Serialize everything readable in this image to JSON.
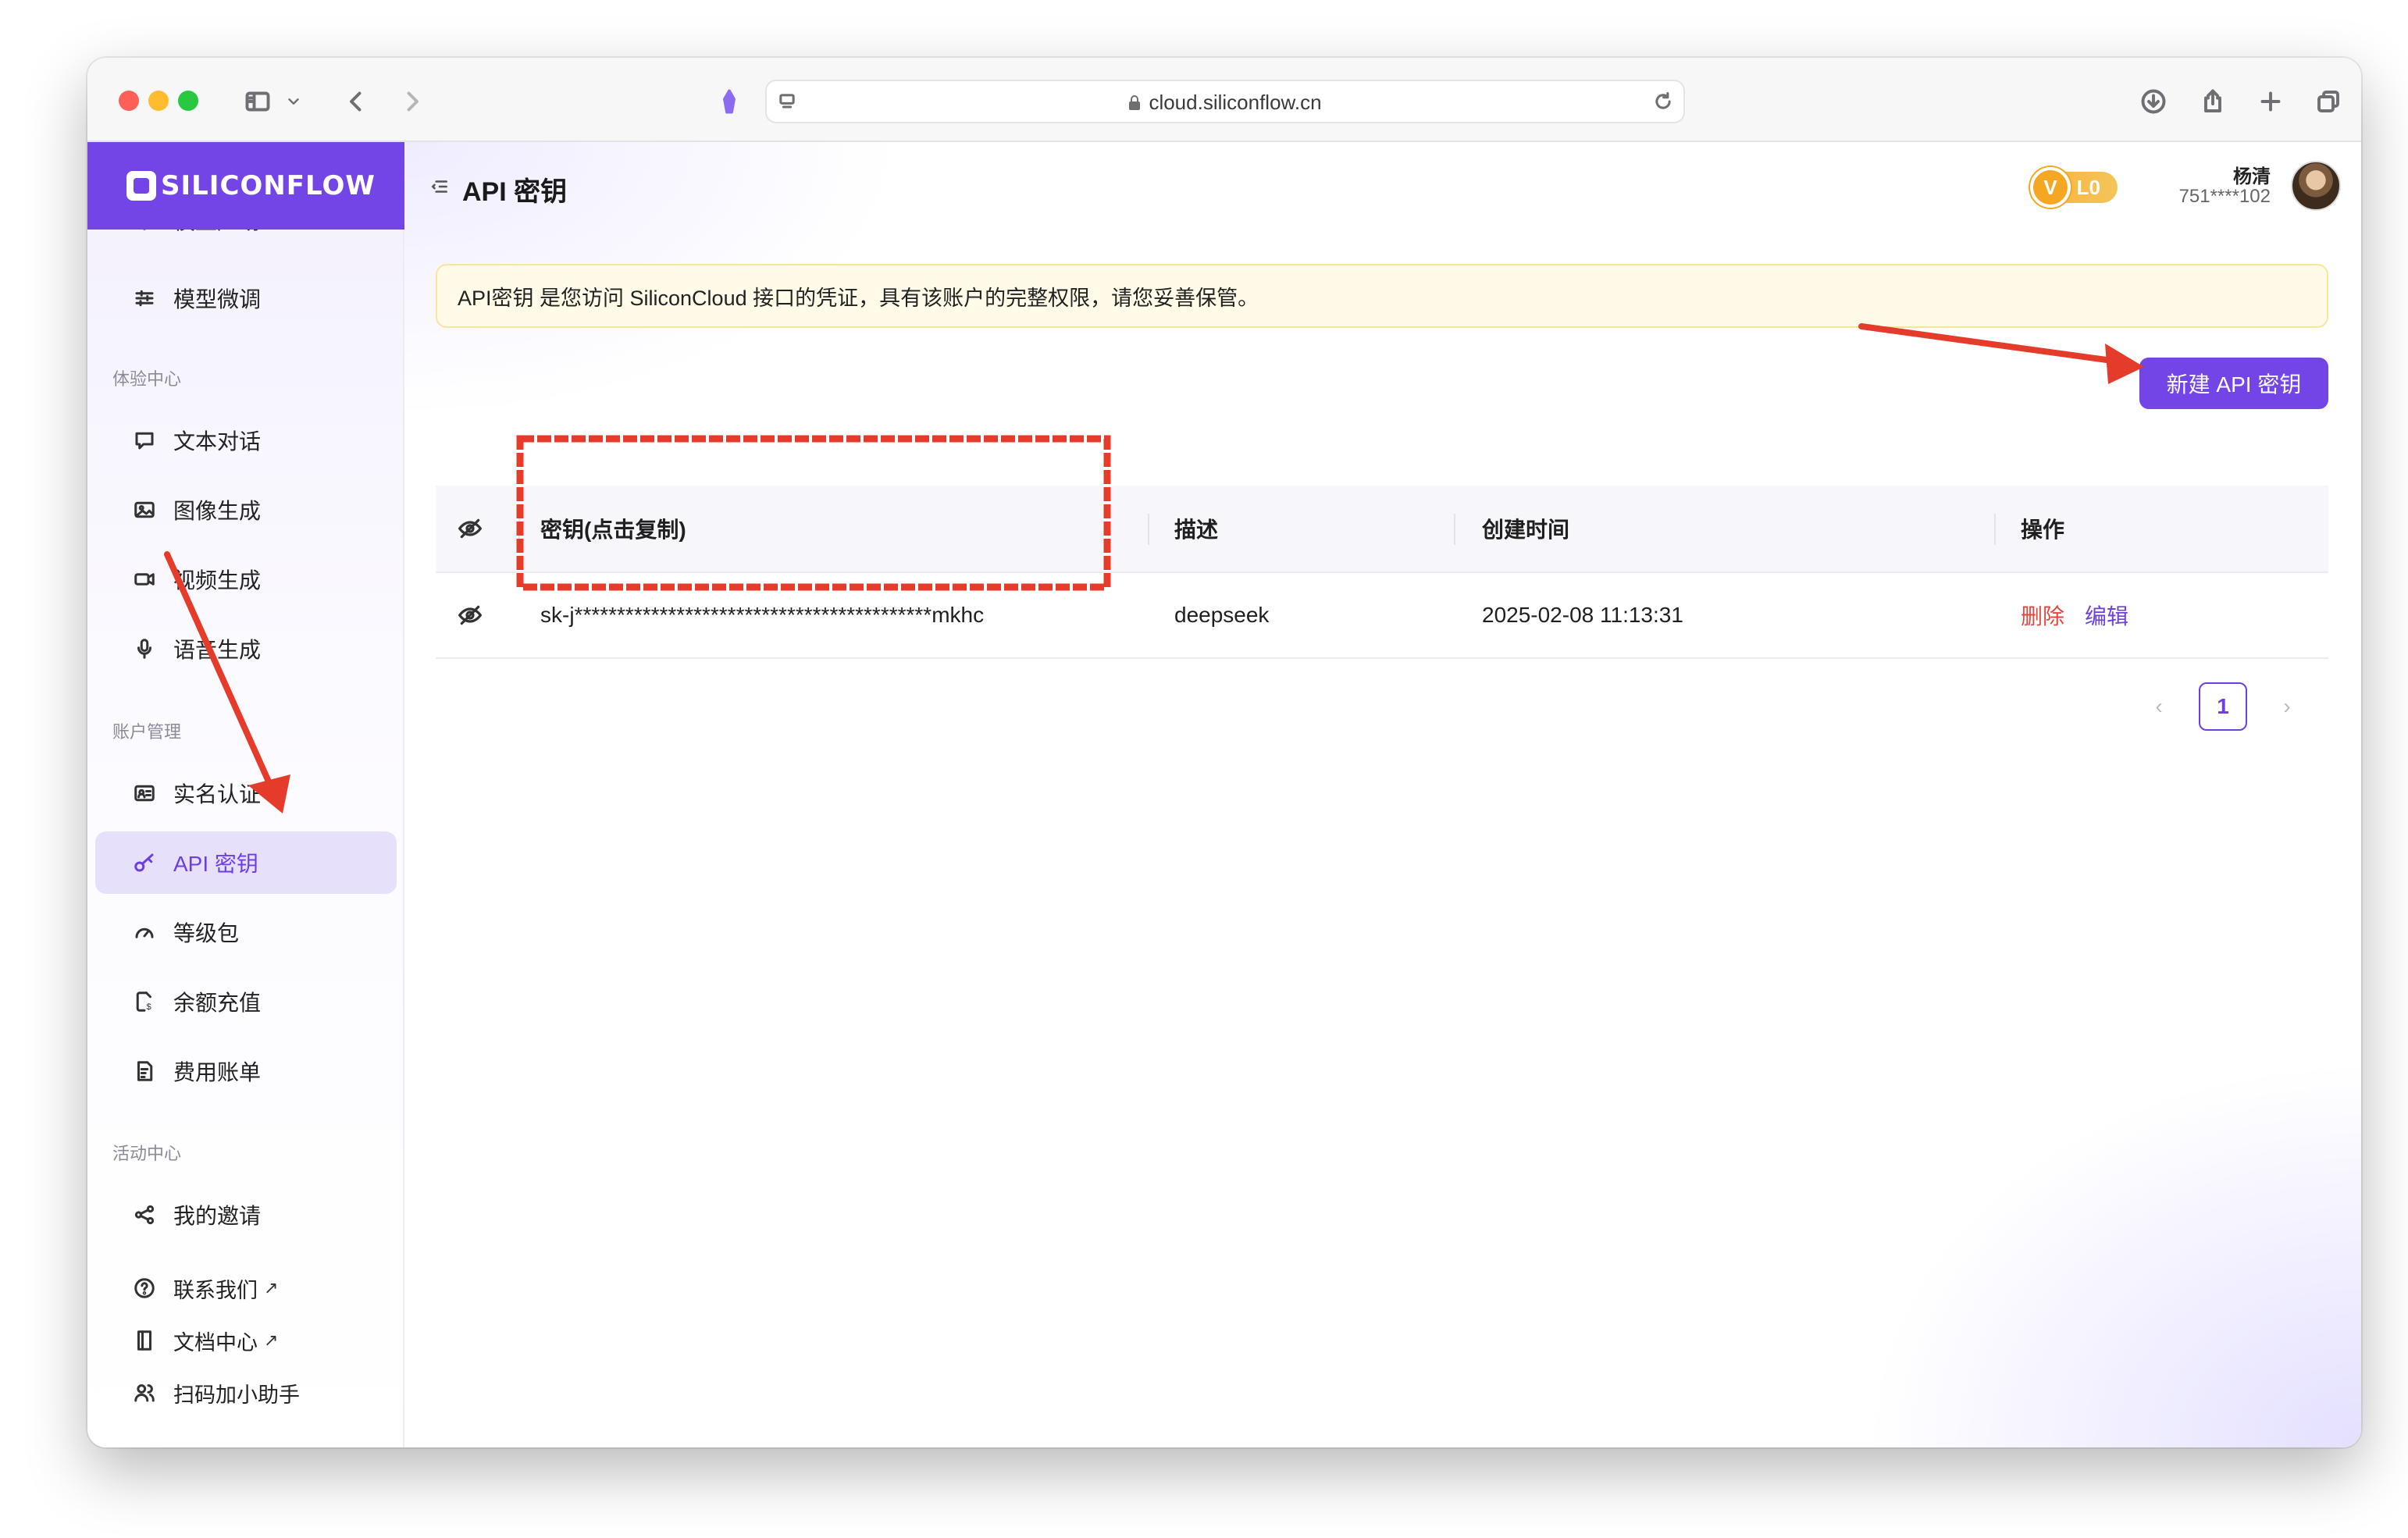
{
  "browser": {
    "url": "cloud.siliconflow.cn"
  },
  "sidebar": {
    "logo": "SILICONFLOW",
    "partial_item": "模型广场",
    "items_top": [
      {
        "label": "模型微调",
        "icon": "sliders-icon"
      }
    ],
    "sections": [
      {
        "title": "体验中心",
        "items": [
          {
            "label": "文本对话",
            "icon": "chat-icon"
          },
          {
            "label": "图像生成",
            "icon": "image-icon"
          },
          {
            "label": "视频生成",
            "icon": "video-icon"
          },
          {
            "label": "语音生成",
            "icon": "microphone-icon"
          }
        ]
      },
      {
        "title": "账户管理",
        "items": [
          {
            "label": "实名认证",
            "icon": "id-card-icon"
          },
          {
            "label": "API 密钥",
            "icon": "key-icon",
            "active": true
          },
          {
            "label": "等级包",
            "icon": "gauge-icon"
          },
          {
            "label": "余额充值",
            "icon": "recharge-icon"
          },
          {
            "label": "费用账单",
            "icon": "bill-icon"
          }
        ]
      },
      {
        "title": "活动中心",
        "items": [
          {
            "label": "我的邀请",
            "icon": "share-icon"
          }
        ]
      }
    ],
    "footer_links": [
      {
        "label": "联系我们",
        "icon": "help-icon",
        "external": "↗"
      },
      {
        "label": "文档中心",
        "icon": "book-icon",
        "external": "↗"
      },
      {
        "label": "扫码加小助手",
        "icon": "users-icon"
      }
    ]
  },
  "header": {
    "title": "API 密钥",
    "badge_v": "V",
    "badge_level": "L0",
    "user_name": "杨清",
    "user_phone": "751****102"
  },
  "notice": "API密钥 是您访问 SiliconCloud 接口的凭证，具有该账户的完整权限，请您妥善保管。",
  "new_key_button": "新建 API 密钥",
  "table": {
    "columns": [
      "密钥(点击复制)",
      "描述",
      "创建时间",
      "操作"
    ],
    "rows": [
      {
        "key": "sk-j******************************************mkhc",
        "description": "deepseek",
        "created": "2025-02-08 11:13:31",
        "actions": [
          "删除",
          "编辑"
        ]
      }
    ]
  },
  "pagination": {
    "prev": "‹",
    "current": "1",
    "next": "›"
  },
  "colors": {
    "brand": "#7445e6",
    "danger": "#e3463d",
    "annotation": "#e53b2a"
  }
}
